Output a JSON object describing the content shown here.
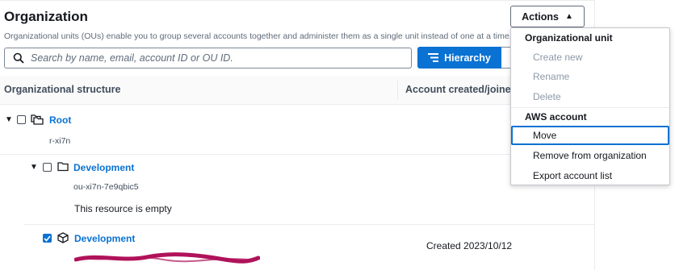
{
  "header": {
    "title": "Organization",
    "description": "Organizational units (OUs) enable you to group several accounts together and administer them as a single unit instead of one at a time.",
    "actions_label": "Actions"
  },
  "search": {
    "placeholder": "Search by name, email, account ID or OU ID.",
    "value": ""
  },
  "view_toggle": {
    "hierarchy_label": "Hierarchy"
  },
  "table": {
    "columns": [
      "Organizational structure",
      "Account created/joined o"
    ],
    "rows": [
      {
        "type": "root",
        "name": "Root",
        "id": "r-xi7n",
        "expanded": true,
        "checked": false
      },
      {
        "type": "ou",
        "name": "Development",
        "id": "ou-xi7n-7e9qbic5",
        "expanded": true,
        "checked": false,
        "empty_message": "This resource is empty"
      },
      {
        "type": "account",
        "name": "Development",
        "created": "Created 2023/10/12",
        "checked": true
      }
    ]
  },
  "actions_menu": {
    "groups": [
      {
        "header": "Organizational unit",
        "items": [
          {
            "label": "Create new",
            "disabled": true
          },
          {
            "label": "Rename",
            "disabled": true
          },
          {
            "label": "Delete",
            "disabled": true
          }
        ]
      },
      {
        "header": "AWS account",
        "items": [
          {
            "label": "Move",
            "disabled": false,
            "focused": true
          },
          {
            "label": "Remove from organization",
            "disabled": false
          },
          {
            "label": "Export account list",
            "disabled": false
          }
        ]
      }
    ]
  },
  "colors": {
    "primary": "#0972d3",
    "text": "#16191f",
    "muted": "#5f6b7a",
    "disabled": "#8d99a8",
    "redaction": "#b0125a"
  },
  "icons": [
    "search-icon",
    "hierarchy-icon",
    "caret-up-icon",
    "expand-down-icon",
    "folder-stack-icon",
    "folder-icon",
    "cube-icon",
    "check-icon"
  ]
}
